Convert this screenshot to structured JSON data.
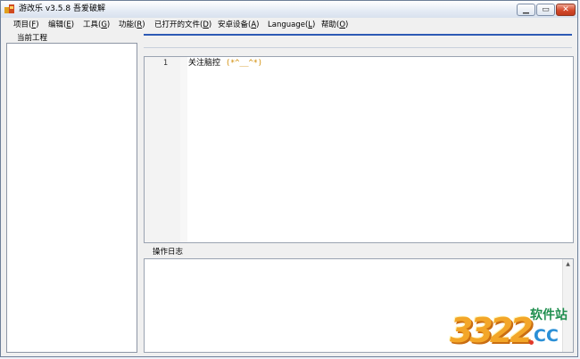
{
  "window": {
    "title": "游改乐 v3.5.8 吾爱破解",
    "minimize_glyph": "▁",
    "maximize_glyph": "▭",
    "close_glyph": "✕",
    "icon": "app-icon"
  },
  "menu": [
    {
      "label": "项目(",
      "key": "F",
      "end": ")"
    },
    {
      "label": "编辑(",
      "key": "E",
      "end": ")"
    },
    {
      "label": "工具(",
      "key": "G",
      "end": ")"
    },
    {
      "label": "功能(",
      "key": "R",
      "end": ")"
    },
    {
      "label": "已打开的文件(",
      "key": "D",
      "end": ")"
    },
    {
      "label": "安卓设备(",
      "key": "A",
      "end": ")"
    },
    {
      "label": "Language(",
      "key": "L",
      "end": ")"
    },
    {
      "label": "帮助(",
      "key": "O",
      "end": ")"
    }
  ],
  "left_panel": {
    "tab_label": "当前工程"
  },
  "editor": {
    "line_number": "1",
    "code_text": "关注脑控",
    "code_emoji": "(*^__^*)"
  },
  "log": {
    "label": "操作日志",
    "scroll_up_glyph": "▲"
  },
  "watermark": {
    "number": "3322",
    "chinese": "软件站",
    "domain": "CC"
  },
  "colors": {
    "accent_line": "#2d5ab5",
    "emoji": "#d08a00",
    "watermark_orange": "#f3a628",
    "watermark_green": "#1f8e4e",
    "watermark_blue": "#2a8fd6"
  }
}
